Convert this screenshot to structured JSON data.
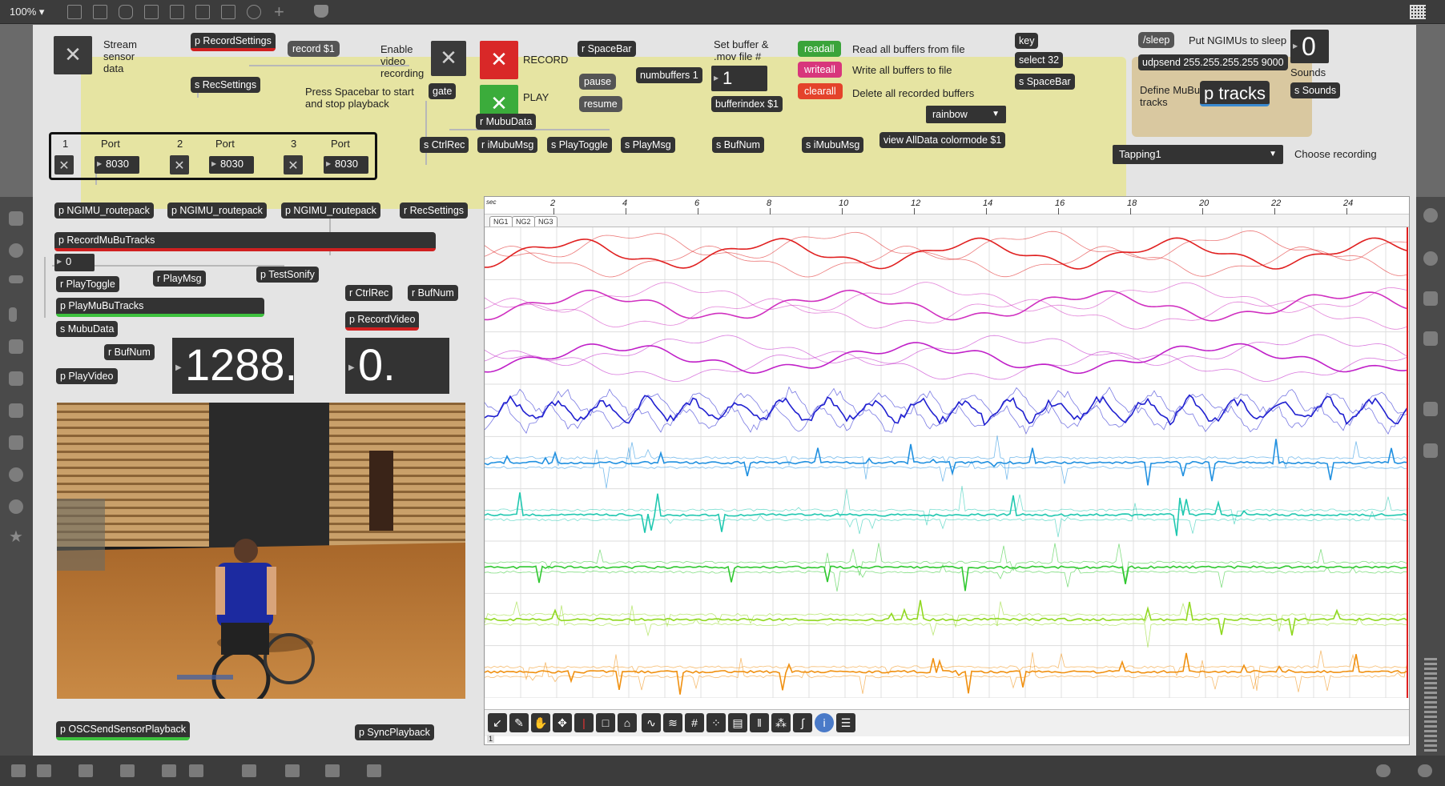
{
  "toolbar": {
    "zoom": "100% ▾"
  },
  "patch": {
    "stream_toggle_label": "Stream\nsensor\ndata",
    "record_settings": "p RecordSettings",
    "record_msg": "record $1",
    "rec_settings_send": "s RecSettings",
    "enable_video_label": "Enable\nvideo\nrecording",
    "gate": "gate",
    "spacebar_hint": "Press Spacebar to start\nand stop playback",
    "record_label": "RECORD",
    "play_label": "PLAY",
    "r_spacebar": "r SpaceBar",
    "pause": "pause",
    "resume": "resume",
    "numbuffers": "numbuffers 1",
    "set_buffer_label": "Set buffer &\n.mov file #",
    "buffer_num": "1",
    "bufferindex": "bufferindex $1",
    "readall": "readall",
    "writeall": "writeall",
    "clearall": "clearall",
    "readall_label": "Read all buffers from file",
    "writeall_label": "Write all buffers to file",
    "clearall_label": "Delete all recorded buffers",
    "colormode": "rainbow",
    "view_alldata": "view AllData colormode $1",
    "key": "key",
    "select32": "select 32",
    "s_spacebar": "s SpaceBar",
    "sleep": "/sleep",
    "sleep_label": "Put NGIMUs to sleep",
    "udpsend": "udpsend 255.255.255.255 9000",
    "sounds_num": "0",
    "sounds_label": "Sounds",
    "define_mubu_label": "Define MuBu\ntracks",
    "p_tracks": "p tracks",
    "s_sounds": "s Sounds",
    "recording_select": "Tapping1",
    "choose_recording_label": "Choose recording",
    "r_mubudata": "r MubuData",
    "s_ctrlrec": "s CtrlRec",
    "r_imubumsg": "r iMubuMsg",
    "s_playtoggle": "s PlayToggle",
    "s_playmsg": "s PlayMsg",
    "s_bufnum": "s BufNum",
    "s_imubumsg": "s iMubuMsg",
    "ports": [
      {
        "id": "1",
        "label": "Port",
        "value": "8030"
      },
      {
        "id": "2",
        "label": "Port",
        "value": "8030"
      },
      {
        "id": "3",
        "label": "Port",
        "value": "8030"
      }
    ],
    "routepack": "p NGIMU_routepack",
    "r_recsettings": "r RecSettings",
    "record_mubu_tracks": "p RecordMuBuTracks",
    "rec_num": "0",
    "r_playtoggle": "r PlayToggle",
    "r_playmsg": "r PlayMsg",
    "test_sonify": "p TestSonify",
    "play_mubu_tracks": "p PlayMuBuTracks",
    "s_mubudata": "s MubuData",
    "r_bufnum": "r BufNum",
    "play_video": "p PlayVideo",
    "big_num_1": "1288.",
    "r_ctrlrec": "r CtrlRec",
    "r_bufnum2": "r BufNum",
    "record_video": "p RecordVideo",
    "big_num_2": "0.",
    "osc_send": "p OSCSendSensorPlayback",
    "sync_playback": "p SyncPlayback"
  },
  "mubu": {
    "ruler_start": "sec",
    "ticks": [
      "2",
      "4",
      "6",
      "8",
      "10",
      "12",
      "14",
      "16",
      "18",
      "20",
      "22",
      "24"
    ],
    "tabs": [
      "NG1",
      "NG2",
      "NG3"
    ],
    "track_colors": [
      "#e02020",
      "#d030c0",
      "#c020c8",
      "#2020d0",
      "#2090e0",
      "#20c8b0",
      "#30c830",
      "#90d820",
      "#f09010"
    ],
    "corner": "1"
  }
}
